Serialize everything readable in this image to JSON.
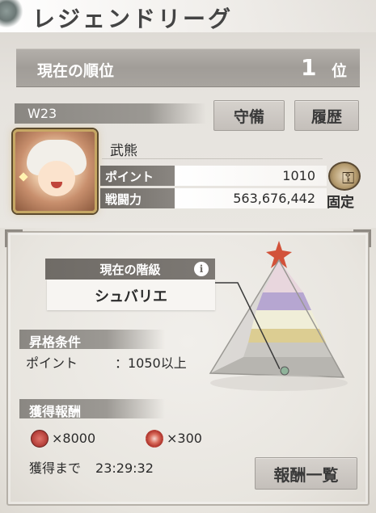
{
  "header": {
    "title": "レジェンドリーグ"
  },
  "rank": {
    "label": "現在の順位",
    "value": "1",
    "unit": "位"
  },
  "week": {
    "label": "W23"
  },
  "buttons": {
    "defense": "守備",
    "history": "履歴",
    "reward_list": "報酬一覧"
  },
  "player": {
    "name": "武熊",
    "points_label": "ポイント",
    "points_value": "1010",
    "power_label": "戦闘力",
    "power_value": "563,676,442",
    "lock_label": "固定"
  },
  "tier": {
    "header": "現在の階級",
    "value": "シュバリエ"
  },
  "promotion": {
    "header": "昇格条件",
    "key": "ポイント",
    "value": "：1050以上"
  },
  "rewards": {
    "header": "獲得報酬",
    "items": [
      {
        "icon": "red-medal-icon",
        "amount": "×8000"
      },
      {
        "icon": "sun-gem-icon",
        "amount": "×300"
      }
    ],
    "until_label": "獲得まで",
    "until_value": "23:29:32"
  },
  "colors": {
    "bar_dark": "#6f6b66",
    "bar_mid": "#a19d98",
    "gold_frame": "#c6a764",
    "medal_red": "#b8433d"
  }
}
